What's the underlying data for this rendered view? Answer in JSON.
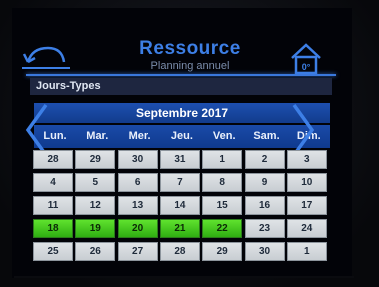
{
  "header": {
    "title": "Ressource",
    "subtitle": "Planning annuel"
  },
  "section": {
    "label": "Jours-Types"
  },
  "calendar": {
    "month_label": "Septembre 2017",
    "weekdays": [
      "Lun.",
      "Mar.",
      "Mer.",
      "Jeu.",
      "Ven.",
      "Sam.",
      "Dim."
    ],
    "weeks": [
      [
        "28",
        "29",
        "30",
        "31",
        "1",
        "2",
        "3"
      ],
      [
        "4",
        "5",
        "6",
        "7",
        "8",
        "9",
        "10"
      ],
      [
        "11",
        "12",
        "13",
        "14",
        "15",
        "16",
        "17"
      ],
      [
        "18",
        "19",
        "20",
        "21",
        "22",
        "23",
        "24"
      ],
      [
        "25",
        "26",
        "27",
        "28",
        "29",
        "30",
        "1"
      ]
    ],
    "highlighted_days": [
      "18",
      "19",
      "20",
      "21",
      "22"
    ]
  },
  "icons": {
    "back": "back-arrow-icon",
    "home": "home-icon",
    "prev": "chevron-left-icon",
    "next": "chevron-right-icon"
  },
  "colors": {
    "accent_blue": "#3a78dc",
    "highlight_green": "#46c81e",
    "cell_gray": "#d4d8dc"
  }
}
